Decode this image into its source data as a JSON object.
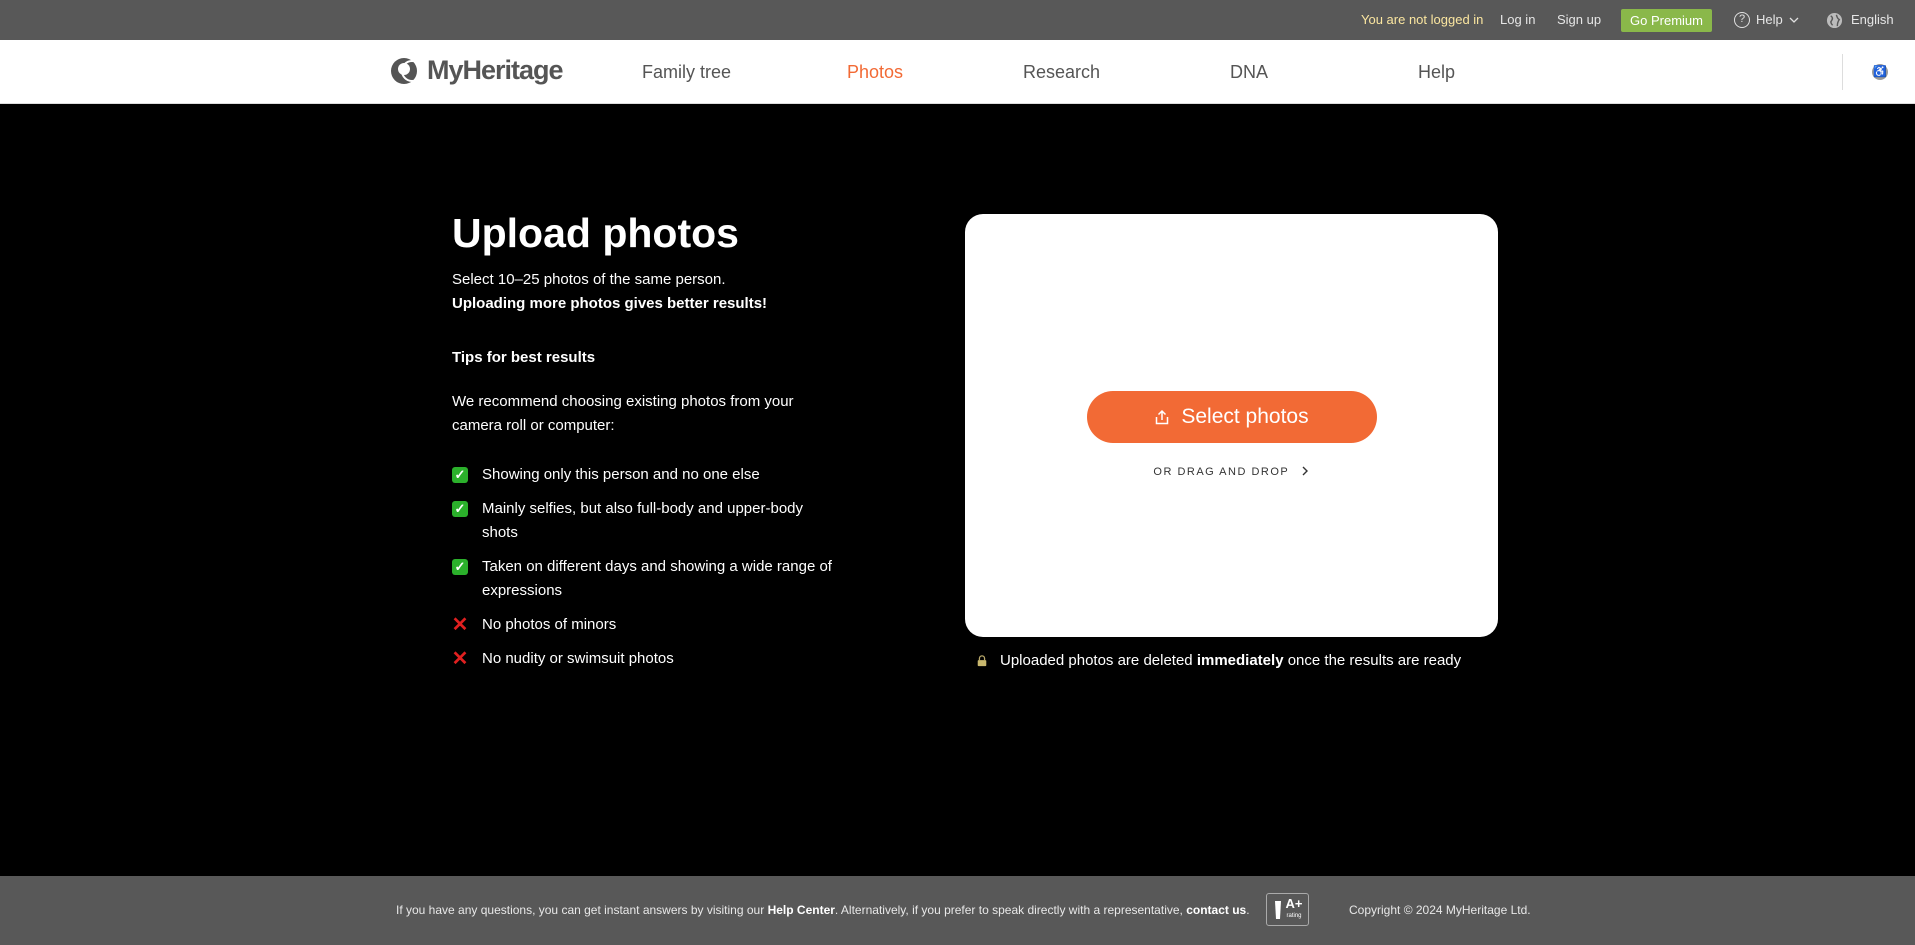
{
  "topbar": {
    "not_logged_in": "You are not logged in",
    "log_in": "Log in",
    "sign_up": "Sign up",
    "go_premium": "Go Premium",
    "help": "Help",
    "language": "English"
  },
  "nav": {
    "logo": "MyHeritage",
    "items": [
      {
        "label": "Family tree"
      },
      {
        "label": "Photos",
        "active": true
      },
      {
        "label": "Research"
      },
      {
        "label": "DNA"
      },
      {
        "label": "Help"
      }
    ]
  },
  "main": {
    "title": "Upload photos",
    "subtitle": "Select 10–25 photos of the same person.",
    "subtitle_bold": "Uploading more photos gives better results!",
    "tips_heading": "Tips for best results",
    "recommend": "We recommend choosing existing photos from your camera roll or computer:",
    "tips": [
      {
        "type": "check",
        "text": "Showing only this person and no one else"
      },
      {
        "type": "check",
        "text": "Mainly selfies, but also full-body and upper-body shots"
      },
      {
        "type": "check",
        "text": "Taken on different days and showing a wide range of expressions"
      },
      {
        "type": "cross",
        "text": "No photos of minors"
      },
      {
        "type": "cross",
        "text": "No nudity or swimsuit photos"
      }
    ]
  },
  "upload": {
    "select_button": "Select photos",
    "drag_drop": "OR DRAG AND DROP",
    "privacy_before": "Uploaded photos are deleted",
    "privacy_bold": "immediately",
    "privacy_after": "once the results are ready"
  },
  "footer": {
    "text_1": "If you have any questions, you can get instant answers by visiting our",
    "help_center": "Help Center",
    "text_2": ". Alternatively, if you prefer to speak directly with a representative,",
    "contact_us": "contact us",
    "text_3": ".",
    "bbb_grade": "A+",
    "bbb_rating": "rating",
    "copyright": "Copyright © 2024 MyHeritage Ltd."
  },
  "colors": {
    "accent": "#f26a35",
    "premium": "#8ab84a",
    "bar": "#585858"
  }
}
